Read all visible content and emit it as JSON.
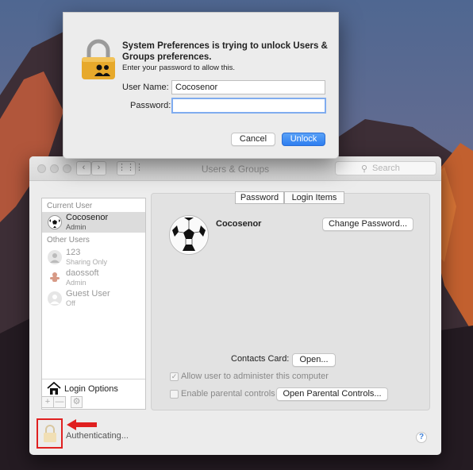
{
  "window": {
    "title": "Users & Groups",
    "search_placeholder": "Search"
  },
  "sidebar": {
    "current_user_header": "Current User",
    "current_user": {
      "name": "Cocosenor",
      "role": "Admin"
    },
    "other_users_header": "Other Users",
    "other_users": [
      {
        "name": "123",
        "role": "Sharing Only"
      },
      {
        "name": "daossoft",
        "role": "Admin"
      },
      {
        "name": "Guest User",
        "role": "Off"
      }
    ],
    "login_options": "Login Options",
    "add_symbol": "+",
    "remove_symbol": "—",
    "gear_symbol": "⚙"
  },
  "tabs": {
    "password": "Password",
    "login_items": "Login Items"
  },
  "detail": {
    "user_name": "Cocosenor",
    "change_password": "Change Password...",
    "contacts_card_label": "Contacts Card:",
    "open_button": "Open...",
    "allow_admin": "Allow user to administer this computer",
    "enable_parental": "Enable parental controls",
    "open_parental": "Open Parental Controls..."
  },
  "footer": {
    "status": "Authenticating...",
    "help": "?"
  },
  "auth_sheet": {
    "heading": "System Preferences is trying to unlock Users & Groups preferences.",
    "subtext": "Enter your password to allow this.",
    "username_label": "User Name:",
    "username_value": "Cocosenor",
    "password_label": "Password:",
    "password_value": "",
    "cancel": "Cancel",
    "unlock": "Unlock"
  },
  "colors": {
    "accent": "#2e7ef0",
    "highlight_box": "#e02020"
  }
}
